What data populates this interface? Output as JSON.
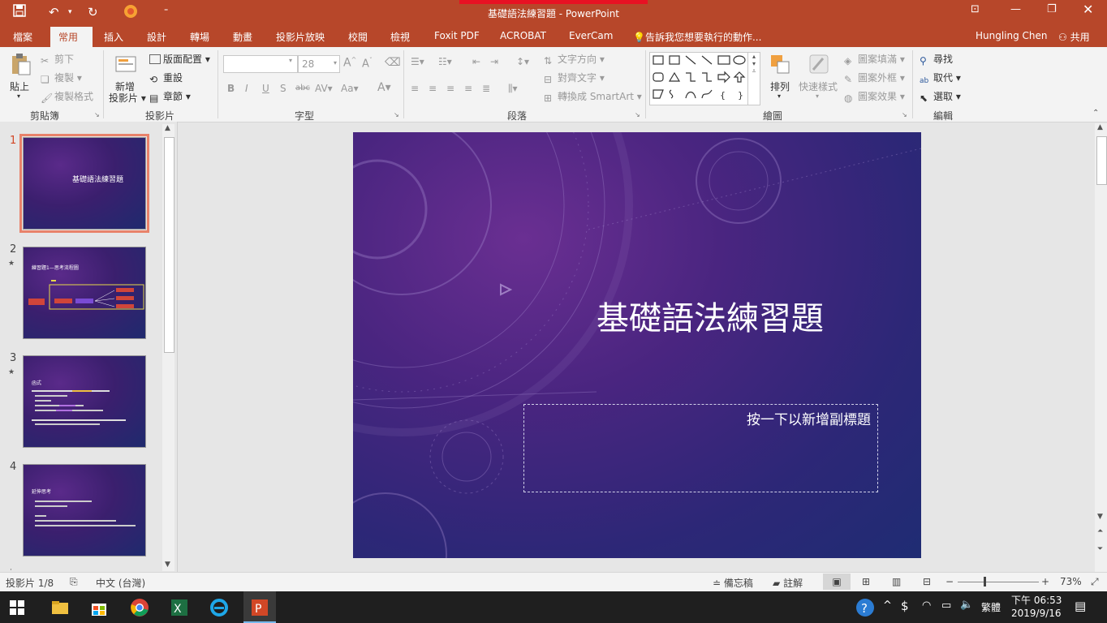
{
  "window": {
    "title": "基礎語法練習題 - PowerPoint"
  },
  "tabs": [
    {
      "label": "檔案"
    },
    {
      "label": "常用"
    },
    {
      "label": "插入"
    },
    {
      "label": "設計"
    },
    {
      "label": "轉場"
    },
    {
      "label": "動畫"
    },
    {
      "label": "投影片放映"
    },
    {
      "label": "校閱"
    },
    {
      "label": "檢視"
    },
    {
      "label": "Foxit PDF"
    },
    {
      "label": "ACROBAT"
    },
    {
      "label": "EverCam"
    },
    {
      "label": "告訴我您想要執行的動作..."
    }
  ],
  "account": {
    "user": "Hungling Chen",
    "share": "共用"
  },
  "ribbon": {
    "clipboard": {
      "paste": "貼上",
      "cut": "剪下",
      "copy": "複製",
      "format_painter": "複製格式",
      "group": "剪貼簿"
    },
    "slides": {
      "new_slide": "新增",
      "new_slide2": "投影片",
      "layout": "版面配置",
      "reset": "重設",
      "section": "章節",
      "group": "投影片"
    },
    "font": {
      "size": "28",
      "group": "字型"
    },
    "paragraph": {
      "text_direction": "文字方向",
      "align_text": "對齊文字",
      "smartart": "轉換成 SmartArt",
      "group": "段落"
    },
    "drawing": {
      "arrange": "排列",
      "quick_styles": "快速樣式",
      "shape_fill": "圖案填滿",
      "shape_outline": "圖案外框",
      "shape_effects": "圖案效果",
      "group": "繪圖"
    },
    "editing": {
      "find": "尋找",
      "replace": "取代",
      "select": "選取",
      "group": "編輯"
    }
  },
  "thumbnails": [
    {
      "num": "1",
      "title": "基礎語法練習題"
    },
    {
      "num": "2",
      "title": "練習題1—思考流程圖"
    },
    {
      "num": "3",
      "title": "函式"
    },
    {
      "num": "4",
      "title": "延伸思考"
    }
  ],
  "slide": {
    "title": "基礎語法練習題",
    "subtitle_placeholder": "按一下以新增副標題"
  },
  "statusbar": {
    "slide_counter": "投影片 1/8",
    "language": "中文 (台灣)",
    "notes": "備忘稿",
    "comments": "註解",
    "zoom": "73%"
  },
  "taskbar": {
    "ime": "繁體",
    "time": "下午 06:53",
    "date": "2019/9/16"
  },
  "colors": {
    "accent": "#b7472a",
    "slide_purple": "#4a2580",
    "selection": "#e8826a"
  }
}
